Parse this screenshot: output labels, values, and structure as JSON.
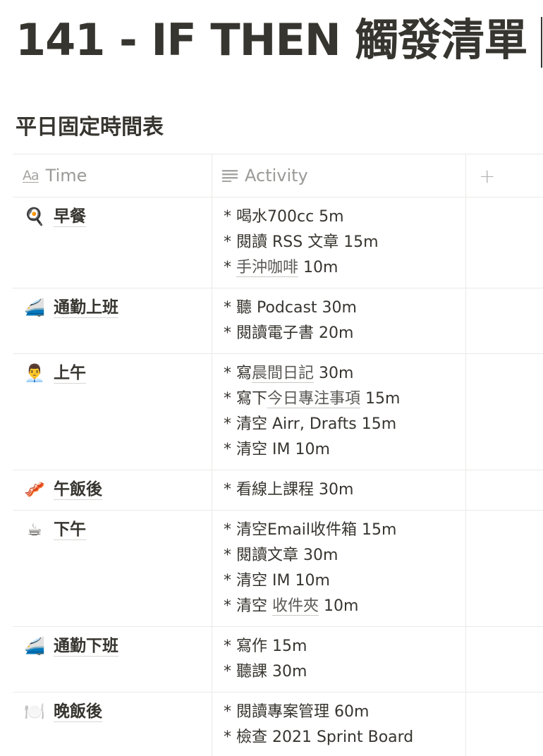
{
  "page": {
    "title": "141 - IF THEN 觸發清單",
    "section_heading": "平日固定時間表"
  },
  "table": {
    "columns": [
      {
        "label": "Time",
        "icon": "text-aa-icon"
      },
      {
        "label": "Activity",
        "icon": "text-lines-icon"
      },
      {
        "label": "",
        "icon": "plus-icon"
      }
    ],
    "rows": [
      {
        "emoji": "🍳",
        "name": "早餐",
        "lines": [
          [
            {
              "t": "* 喝水700cc 5m"
            }
          ],
          [
            {
              "t": "* 閱讀 RSS 文章 15m"
            }
          ],
          [
            {
              "t": "* "
            },
            {
              "t": "手沖咖啡",
              "link": true
            },
            {
              "t": " 10m"
            }
          ]
        ]
      },
      {
        "emoji": "🚄",
        "name": "通勤上班",
        "lines": [
          [
            {
              "t": "* 聽 Podcast 30m"
            }
          ],
          [
            {
              "t": "* 閱讀電子書 20m"
            }
          ]
        ]
      },
      {
        "emoji": "👨‍💼",
        "name": "上午",
        "lines": [
          [
            {
              "t": "* 寫"
            },
            {
              "t": "晨間日記",
              "link": true
            },
            {
              "t": " 30m"
            }
          ],
          [
            {
              "t": "* 寫下"
            },
            {
              "t": "今日專注事項",
              "link": true
            },
            {
              "t": " 15m"
            }
          ],
          [
            {
              "t": "* 清空 Airr, Drafts 15m"
            }
          ],
          [
            {
              "t": "* 清空 IM 10m"
            }
          ]
        ]
      },
      {
        "emoji": "🥓",
        "name": "午飯後",
        "lines": [
          [
            {
              "t": "* 看線上課程 30m"
            }
          ]
        ]
      },
      {
        "emoji": "☕",
        "name": "下午",
        "lines": [
          [
            {
              "t": "* 清空Email收件箱 15m"
            }
          ],
          [
            {
              "t": "* 閱讀文章 30m"
            }
          ],
          [
            {
              "t": "* 清空 IM 10m"
            }
          ],
          [
            {
              "t": "* 清空 "
            },
            {
              "t": "收件夾",
              "link": true
            },
            {
              "t": " 10m"
            }
          ]
        ]
      },
      {
        "emoji": "🚄",
        "name": "通勤下班",
        "lines": [
          [
            {
              "t": "* 寫作 15m"
            }
          ],
          [
            {
              "t": "* 聽課 30m"
            }
          ]
        ]
      },
      {
        "emoji": "🍽️",
        "name": "晚飯後",
        "lines": [
          [
            {
              "t": "* 閱讀專案管理 60m"
            }
          ],
          [
            {
              "t": "* 檢查 2021 Sprint Board"
            }
          ]
        ]
      }
    ]
  }
}
